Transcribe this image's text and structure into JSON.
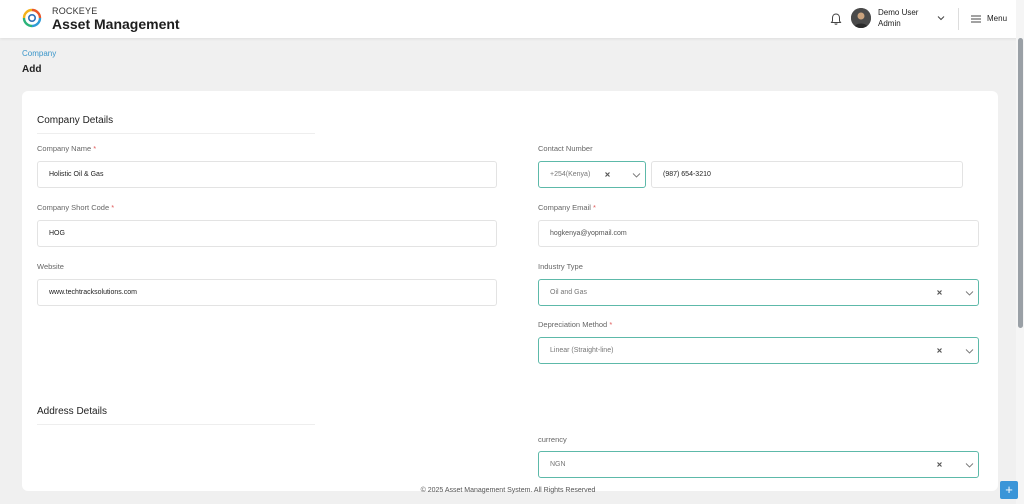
{
  "header": {
    "brand_top": "ROCKEYE",
    "brand_main": "Asset Management",
    "user_name": "Demo User",
    "user_role": "Admin",
    "menu_label": "Menu"
  },
  "breadcrumb": "Company",
  "page_title": "Add",
  "company_details": {
    "title": "Company Details",
    "company_name": {
      "label": "Company Name",
      "value": "Holistic Oil & Gas"
    },
    "short_code": {
      "label": "Company Short Code",
      "value": "HOG"
    },
    "website": {
      "label": "Website",
      "value": "www.techtracksolutions.com"
    },
    "contact": {
      "label": "Contact Number",
      "country_code": "+254(Kenya)",
      "number": "(987) 654-3210"
    },
    "email": {
      "label": "Company Email",
      "value": "hogkenya@yopmail.com"
    },
    "industry": {
      "label": "Industry Type",
      "value": "Oil and Gas"
    },
    "depreciation": {
      "label": "Depreciation Method",
      "value": "Linear (Straight-line)"
    }
  },
  "address_details": {
    "title": "Address Details",
    "currency": {
      "label": "currency",
      "value": "NGN"
    }
  },
  "required_mark": "*",
  "footer": "© 2025 Asset Management System. All Rights Reserved",
  "fab_label": "+",
  "colors": {
    "accent": "#5db9a9",
    "link": "#3a95c9",
    "required": "#e05a5a",
    "fab": "#3a95d8"
  }
}
